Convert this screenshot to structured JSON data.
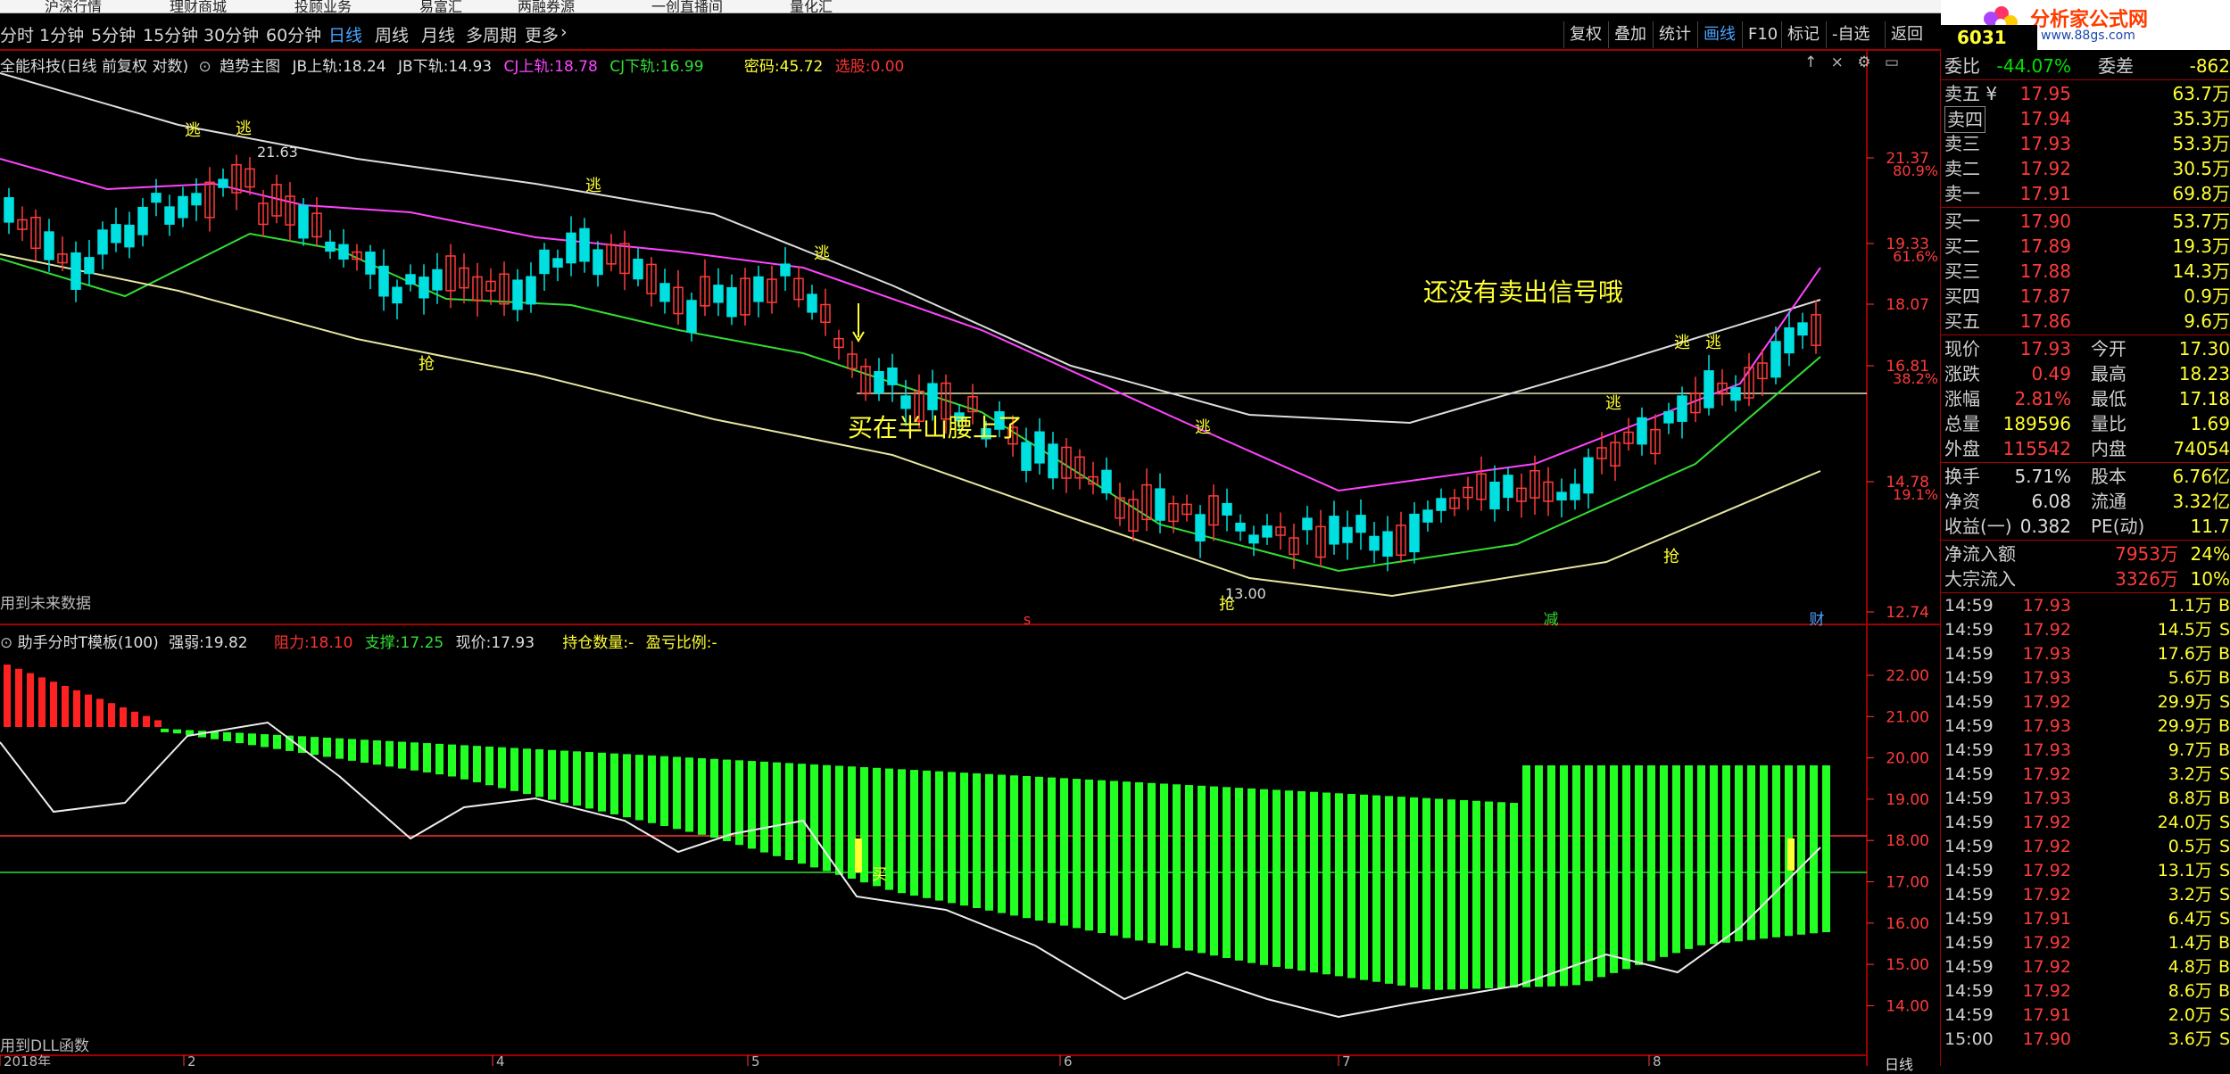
{
  "top_menu": [
    "沪深行情",
    "理财商城",
    "投顾业务",
    "易富汇",
    "两融券源",
    "一创直播间",
    "量化汇"
  ],
  "period_bar": {
    "items": [
      "分时",
      "1分钟",
      "5分钟",
      "15分钟",
      "30分钟",
      "60分钟",
      "日线",
      "周线",
      "月线",
      "多周期",
      "更多"
    ],
    "selected": "日线"
  },
  "right_toolbar": {
    "items": [
      "复权",
      "叠加",
      "统计",
      "画线",
      "F10",
      "标记",
      "-自选",
      "返回"
    ],
    "selected": "画线"
  },
  "logo": {
    "title": "分析家公式网",
    "url": "www.88gs.com"
  },
  "stock_code": "6031",
  "main_chart": {
    "title": "全能科技(日线 前复权 对数)",
    "indicator": "趋势主图",
    "jb_up_label": "JB上轨:",
    "jb_up_value": "18.24",
    "jb_down_label": "JB下轨:",
    "jb_down_value": "14.93",
    "cj_up_label": "CJ上轨:",
    "cj_up_value": "18.78",
    "cj_down_label": "CJ下轨:",
    "cj_down_value": "16.99",
    "mima_label": "密码:",
    "mima_value": "45.72",
    "xuangu_label": "选股:",
    "xuangu_value": "0.00",
    "annotation_sell": "还没有卖出信号哦",
    "annotation_buy": "买在半山腰上了",
    "high_label": "21.63",
    "low_label": "13.00",
    "bottom_note": "用到未来数据",
    "marker_flee": "逃",
    "marker_grab": "抢",
    "marker_jian": "减",
    "marker_cai": "财",
    "marker_s": "s",
    "axis_right": [
      {
        "v": "21.37",
        "p": "80.9%"
      },
      {
        "v": "19.33",
        "p": "61.6%"
      },
      {
        "v": "18.07",
        "p": ""
      },
      {
        "v": "16.81",
        "p": "38.2%"
      },
      {
        "v": "14.78",
        "p": "19.1%"
      },
      {
        "v": "12.74",
        "p": ""
      }
    ]
  },
  "sub_chart": {
    "title": "助手分时T模板(100)",
    "strength_label": "强弱:",
    "strength_value": "19.82",
    "resist_label": "阻力:",
    "resist_value": "18.10",
    "support_label": "支撑:",
    "support_value": "17.25",
    "price_label": "现价:",
    "price_value": "17.93",
    "hold_label": "持仓数量:",
    "hold_value": "-",
    "pl_label": "盈亏比例:",
    "pl_value": "-",
    "buy_marker": "买",
    "bottom_note": "用到DLL函数",
    "axis_right": [
      "22.00",
      "21.00",
      "20.00",
      "19.00",
      "18.00",
      "17.00",
      "16.00",
      "15.00",
      "14.00"
    ]
  },
  "bottom_axis": [
    "2018年",
    "2",
    "4",
    "5",
    "6",
    "7",
    "8"
  ],
  "bottom_axis_right": "日线",
  "quote": {
    "weibi_label": "委比",
    "weibi_value": "-44.07%",
    "weicha_label": "委差",
    "weicha_value": "-862",
    "asks": [
      {
        "label": "卖五",
        "flag": "¥",
        "price": "17.95",
        "vol": "63.7万"
      },
      {
        "label": "卖四",
        "flag": "",
        "price": "17.94",
        "vol": "35.3万"
      },
      {
        "label": "卖三",
        "flag": "",
        "price": "17.93",
        "vol": "53.3万"
      },
      {
        "label": "卖二",
        "flag": "",
        "price": "17.92",
        "vol": "30.5万"
      },
      {
        "label": "卖一",
        "flag": "",
        "price": "17.91",
        "vol": "69.8万"
      }
    ],
    "bids": [
      {
        "label": "买一",
        "price": "17.90",
        "vol": "53.7万"
      },
      {
        "label": "买二",
        "price": "17.89",
        "vol": "19.3万"
      },
      {
        "label": "买三",
        "price": "17.88",
        "vol": "14.3万"
      },
      {
        "label": "买四",
        "price": "17.87",
        "vol": "0.9万"
      },
      {
        "label": "买五",
        "price": "17.86",
        "vol": "9.6万"
      }
    ],
    "stats": [
      {
        "l1": "现价",
        "v1": "17.93",
        "c1": "red",
        "l2": "今开",
        "v2": "17.30",
        "c2": "red"
      },
      {
        "l1": "涨跌",
        "v1": "0.49",
        "c1": "red",
        "l2": "最高",
        "v2": "18.23",
        "c2": "red"
      },
      {
        "l1": "涨幅",
        "v1": "2.81%",
        "c1": "red",
        "l2": "最低",
        "v2": "17.18",
        "c2": "red"
      },
      {
        "l1": "总量",
        "v1": "189596",
        "c1": "yel",
        "l2": "量比",
        "v2": "1.69",
        "c2": "red"
      },
      {
        "l1": "外盘",
        "v1": "115542",
        "c1": "red",
        "l2": "内盘",
        "v2": "74054",
        "c2": "grn"
      }
    ],
    "stats2": [
      {
        "l1": "换手",
        "v1": "5.71%",
        "c1": "wht",
        "l2": "股本",
        "v2": "6.76亿",
        "c2": "wht"
      },
      {
        "l1": "净资",
        "v1": "6.08",
        "c1": "wht",
        "l2": "流通",
        "v2": "3.32亿",
        "c2": "wht"
      },
      {
        "l1": "收益(一)",
        "v1": "0.382",
        "c1": "wht",
        "l2": "PE(动)",
        "v2": "11.7",
        "c2": "wht"
      }
    ],
    "flows": [
      {
        "label": "净流入额",
        "value": "7953万",
        "pct": "24%"
      },
      {
        "label": "大宗流入",
        "value": "3326万",
        "pct": "10%"
      }
    ],
    "ticks": [
      {
        "t": "14:59",
        "p": "17.93",
        "v": "1.1万",
        "f": "B"
      },
      {
        "t": "14:59",
        "p": "17.92",
        "v": "14.5万",
        "f": "S"
      },
      {
        "t": "14:59",
        "p": "17.93",
        "v": "17.6万",
        "f": "B"
      },
      {
        "t": "14:59",
        "p": "17.93",
        "v": "5.6万",
        "f": "B"
      },
      {
        "t": "14:59",
        "p": "17.92",
        "v": "29.9万",
        "f": "S"
      },
      {
        "t": "14:59",
        "p": "17.93",
        "v": "29.9万",
        "f": "B"
      },
      {
        "t": "14:59",
        "p": "17.93",
        "v": "9.7万",
        "f": "B"
      },
      {
        "t": "14:59",
        "p": "17.92",
        "v": "3.2万",
        "f": "S"
      },
      {
        "t": "14:59",
        "p": "17.93",
        "v": "8.8万",
        "f": "B"
      },
      {
        "t": "14:59",
        "p": "17.92",
        "v": "24.0万",
        "f": "S"
      },
      {
        "t": "14:59",
        "p": "17.92",
        "v": "0.5万",
        "f": "S"
      },
      {
        "t": "14:59",
        "p": "17.92",
        "v": "13.1万",
        "f": "S"
      },
      {
        "t": "14:59",
        "p": "17.92",
        "v": "3.2万",
        "f": "S"
      },
      {
        "t": "14:59",
        "p": "17.91",
        "v": "6.4万",
        "f": "S"
      },
      {
        "t": "14:59",
        "p": "17.92",
        "v": "1.4万",
        "f": "B"
      },
      {
        "t": "14:59",
        "p": "17.92",
        "v": "4.8万",
        "f": "B"
      },
      {
        "t": "14:59",
        "p": "17.92",
        "v": "8.6万",
        "f": "B"
      },
      {
        "t": "14:59",
        "p": "17.91",
        "v": "2.0万",
        "f": "S"
      },
      {
        "t": "15:00",
        "p": "17.90",
        "v": "3.6万",
        "f": "S"
      }
    ]
  },
  "colors": {
    "up": "#ff3b3b",
    "down": "#00e0e0",
    "bull_bar": "#22ff22",
    "panel_border": "#a00000"
  }
}
